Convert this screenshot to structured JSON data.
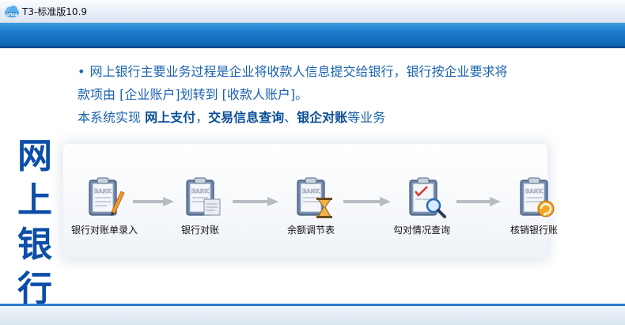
{
  "window": {
    "title": "T3-标准版10.9"
  },
  "intro": {
    "bullet": "•",
    "line1": "网上银行主要业务过程是企业将收款人信息提交给银行，银行按企业要求将",
    "line2": "款项由 [企业账户]划转到 [收款人账户]。",
    "line3_prefix": "本系统实现 ",
    "line3_b1": "网上支付",
    "line3_sep1": "，",
    "line3_b2": "交易信息查询",
    "line3_sep2": "、",
    "line3_b3": "银企对账",
    "line3_suffix": "等业务"
  },
  "module_title": [
    "网",
    "上",
    "银",
    "行"
  ],
  "flow": {
    "steps": [
      {
        "label": "银行对账单录入",
        "icon": "bank-statement-entry-icon"
      },
      {
        "label": "银行对账",
        "icon": "bank-reconciliation-icon"
      },
      {
        "label": "余额调节表",
        "icon": "balance-adjustment-icon"
      },
      {
        "label": "勾对情况查询",
        "icon": "check-query-icon"
      },
      {
        "label": "核销银行账",
        "icon": "write-off-icon"
      }
    ],
    "icon_text": "BANK"
  },
  "colors": {
    "accent_blue": "#1f7ccc",
    "title_blue": "#0b4ea8",
    "text_blue": "#1a63b0"
  }
}
